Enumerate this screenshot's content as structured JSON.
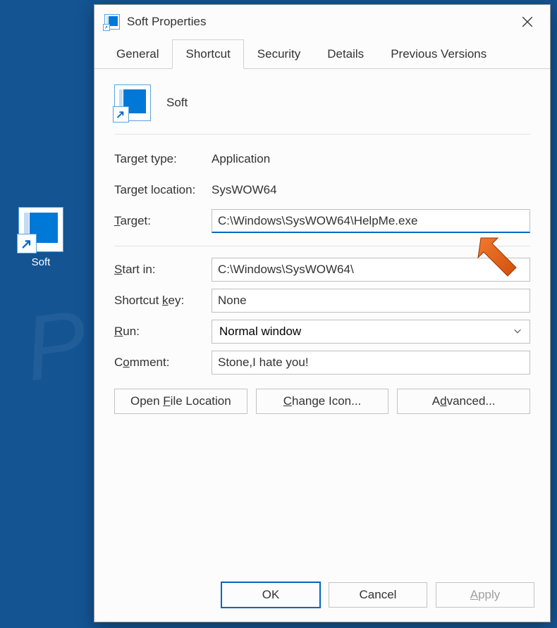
{
  "desktop": {
    "icon_label": "Soft"
  },
  "dialog": {
    "title": "Soft Properties",
    "tabs": [
      "General",
      "Shortcut",
      "Security",
      "Details",
      "Previous Versions"
    ],
    "active_tab_index": 1,
    "item_name": "Soft",
    "target_type_label": "Target type:",
    "target_type_value": "Application",
    "target_location_label": "Target location:",
    "target_location_value": "SysWOW64",
    "target_label_pre": "T",
    "target_label_post": "arget:",
    "target_value": "C:\\Windows\\SysWOW64\\HelpMe.exe",
    "start_in_label_pre": "S",
    "start_in_label_post": "tart in:",
    "start_in_value": "C:\\Windows\\SysWOW64\\",
    "shortcut_key_label_pre": "Shortcut ",
    "shortcut_key_label_u": "k",
    "shortcut_key_label_post": "ey:",
    "shortcut_key_value": "None",
    "run_label_pre": "R",
    "run_label_post": "un:",
    "run_value": "Normal window",
    "comment_label_pre": "C",
    "comment_label_u": "o",
    "comment_label_post": "mment:",
    "comment_value": "Stone,I hate you!",
    "buttons": {
      "open_file_location_pre": "Open ",
      "open_file_location_u": "F",
      "open_file_location_post": "ile Location",
      "change_icon_u": "C",
      "change_icon_post": "hange Icon...",
      "advanced_pre": "A",
      "advanced_u": "d",
      "advanced_post": "vanced..."
    },
    "footer": {
      "ok": "OK",
      "cancel": "Cancel",
      "apply_pre": "A",
      "apply_post": "pply"
    }
  },
  "watermark": "PCrisk.com"
}
